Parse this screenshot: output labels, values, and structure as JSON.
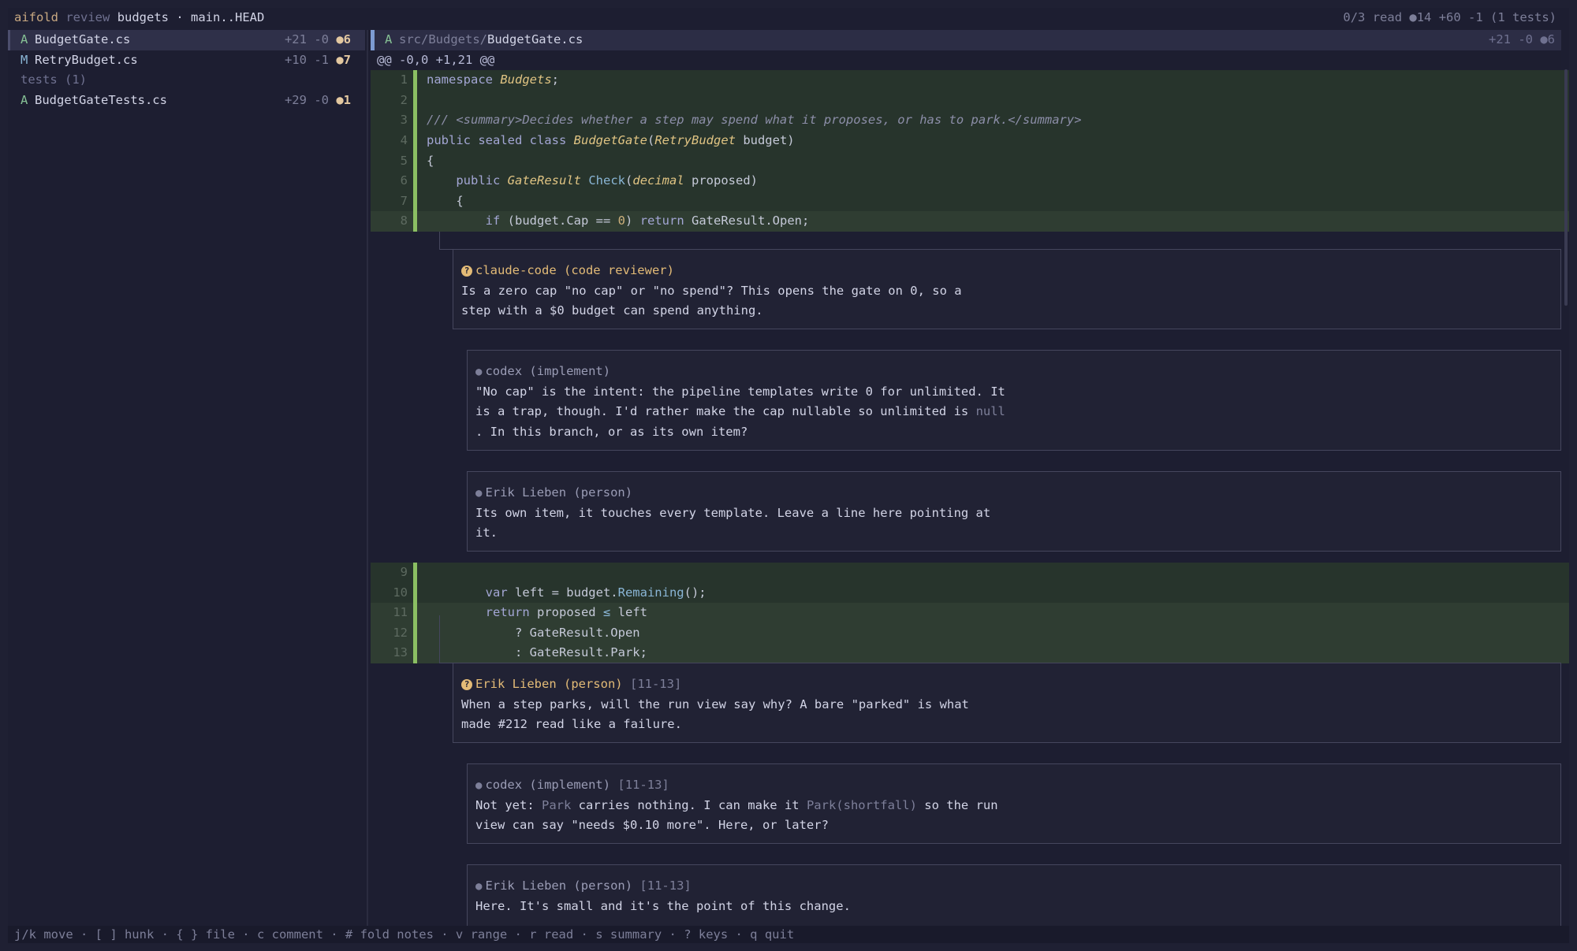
{
  "topbar": {
    "app": "aifold",
    "mode": "review",
    "branch": "budgets · main..HEAD",
    "status": "0/3 read  ●14  +60 -1  (1 tests)"
  },
  "sidebar": {
    "files": [
      {
        "status": "A",
        "name": "BudgetGate.cs",
        "added": "+21",
        "removed": "-0",
        "notes": "●6"
      },
      {
        "status": "M",
        "name": "RetryBudget.cs",
        "added": "+10",
        "removed": "-1",
        "notes": "●7"
      }
    ],
    "tests_header": "tests (1)",
    "tests": [
      {
        "status": "A",
        "name": "BudgetGateTests.cs",
        "added": "+29",
        "removed": "-0",
        "notes": "●1"
      }
    ]
  },
  "file_header": {
    "status": "A",
    "path": "src/Budgets/",
    "name": "BudgetGate.cs",
    "stats": "+21 -0 ●6"
  },
  "hunk": "@@ -0,0 +1,21 @@",
  "code_lines_1": [
    {
      "n": "1"
    },
    {
      "n": "2"
    },
    {
      "n": "3"
    },
    {
      "n": "4"
    },
    {
      "n": "5"
    },
    {
      "n": "6"
    },
    {
      "n": "7"
    },
    {
      "n": "8"
    }
  ],
  "code_lines_2": [
    {
      "n": "9"
    },
    {
      "n": "10"
    },
    {
      "n": "11"
    },
    {
      "n": "12"
    },
    {
      "n": "13"
    }
  ],
  "code": {
    "l1_kw": "namespace",
    "l1_ty": "Budgets",
    "l1_end": ";",
    "l3_cm": "/// <summary>Decides whether a step may spend what it proposes, or has to park.</summary>",
    "l4_kw": "public sealed class",
    "l4_ty": "BudgetGate",
    "l4_p1": "(",
    "l4_ty2": "RetryBudget",
    "l4_p2": " budget)",
    "l5": "{",
    "l6_kw": "public",
    "l6_ty": "GateResult",
    "l6_fn": "Check",
    "l6_p1": "(",
    "l6_ty2": "decimal",
    "l6_p2": " proposed)",
    "l7": "{",
    "l8_kw": "if",
    "l8_p1": " (budget.Cap ",
    "l8_op": "==",
    "l8_nm": "0",
    "l8_p2": ") ",
    "l8_kw2": "return",
    "l8_p3": " GateResult.Open;",
    "l10_kw": "var",
    "l10_p1": " left = budget.",
    "l10_fn": "Remaining",
    "l10_p2": "();",
    "l11_kw": "return",
    "l11_p1": " proposed ",
    "l11_op": "≤",
    "l11_p2": " left",
    "l12": "? GateResult.Open",
    "l13": ": GateResult.Park;"
  },
  "notes": {
    "n1": {
      "author": "claude-code (code reviewer)",
      "range": "",
      "body1": "Is a zero cap \"no cap\" or \"no spend\"? This opens the gate on 0, so a",
      "body2": "step with a $0 budget can spend anything."
    },
    "n2": {
      "author": "codex (implement)",
      "range": "",
      "body1": "\"No cap\" is the intent: the pipeline templates write 0 for unlimited. It",
      "body2a": "is a trap, though. I'd rather make the cap nullable so unlimited is ",
      "body2b": "null",
      "body3": ". In this branch, or as its own item?"
    },
    "n3": {
      "author": "Erik Lieben (person)",
      "range": "",
      "body1": "Its own item, it touches every template. Leave a line here pointing at",
      "body2": "it."
    },
    "n4": {
      "author": "Erik Lieben (person)",
      "range": "[11-13]",
      "body1": "When a step parks, will the run view say why? A bare \"parked\" is what",
      "body2": "made #212 read like a failure."
    },
    "n5": {
      "author": "codex (implement)",
      "range": "[11-13]",
      "body1a": "Not yet: ",
      "body1b": "Park",
      "body1c": " carries nothing. I can make it ",
      "body1d": "Park(shortfall)",
      "body1e": " so the run",
      "body2": "view can say \"needs $0.10 more\". Here, or later?"
    },
    "n6": {
      "author": "Erik Lieben (person)",
      "range": "[11-13]",
      "body1": "Here. It's small and it's the point of this change."
    }
  },
  "footer": "j/k move · [ ] hunk · { } file · c comment · # fold notes · v range · r read · s summary · ? keys · q quit",
  "icons": {
    "question": "?",
    "bubble": "●"
  }
}
